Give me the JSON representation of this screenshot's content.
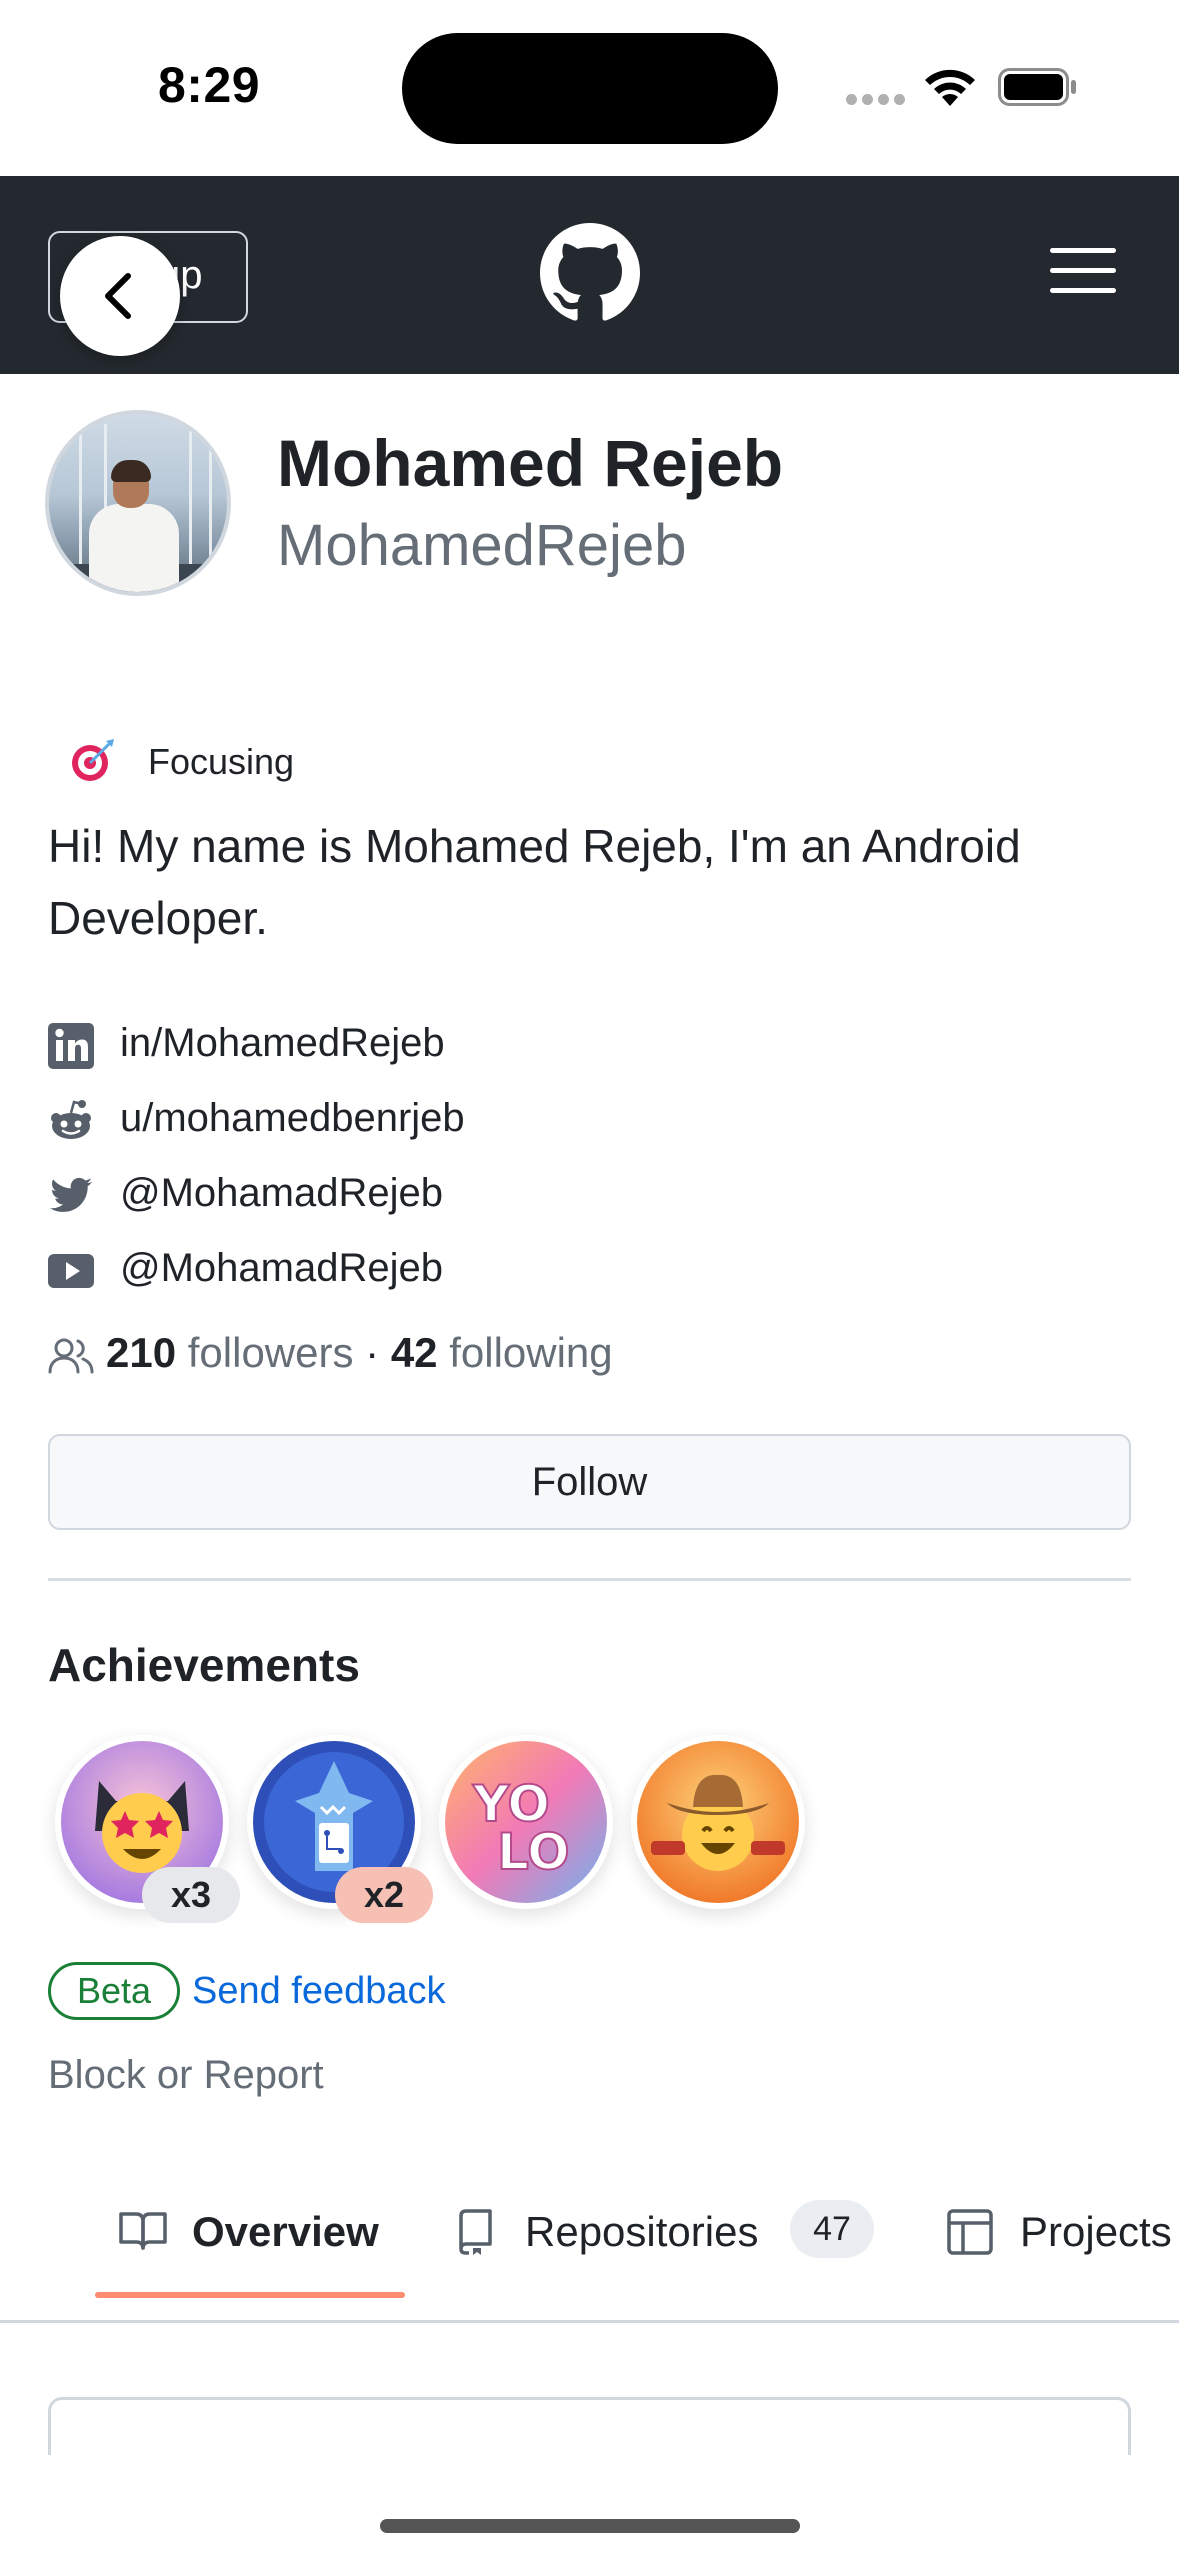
{
  "status_bar": {
    "time": "8:29"
  },
  "header": {
    "signup_label": "up"
  },
  "profile": {
    "full_name": "Mohamed Rejeb",
    "login": "MohamedRejeb",
    "status": "Focusing",
    "bio": "Hi! My name is Mohamed Rejeb, I'm an Android Developer."
  },
  "social_links": [
    {
      "icon": "linkedin-icon",
      "text": "in/MohamedRejeb"
    },
    {
      "icon": "reddit-icon",
      "text": "u/mohamedbenrjeb"
    },
    {
      "icon": "twitter-icon",
      "text": "@MohamadRejeb"
    },
    {
      "icon": "youtube-icon",
      "text": "@MohamadRejeb"
    }
  ],
  "follow_stats": {
    "followers_count": "210",
    "followers_label": "followers",
    "separator": "·",
    "following_count": "42",
    "following_label": "following"
  },
  "follow_button": "Follow",
  "achievements": {
    "title": "Achievements",
    "badges": [
      {
        "icon": "starstruck-badge-icon",
        "count": "x3"
      },
      {
        "icon": "pull-shark-badge-icon",
        "count": "x2"
      },
      {
        "icon": "yolo-badge-icon"
      },
      {
        "icon": "quickdraw-cowboy-badge-icon"
      }
    ],
    "beta_label": "Beta",
    "feedback_link": "Send feedback"
  },
  "block_report": "Block or Report",
  "tabs": [
    {
      "label": "Overview",
      "icon": "book-icon",
      "active": true
    },
    {
      "label": "Repositories",
      "icon": "repo-icon",
      "counter": "47"
    },
    {
      "label": "Projects",
      "icon": "table-icon"
    }
  ],
  "colors": {
    "header_bg": "#24292f",
    "link": "#0969da",
    "beta_green": "#1a7f37",
    "active_tab_underline": "#fd8c73"
  }
}
